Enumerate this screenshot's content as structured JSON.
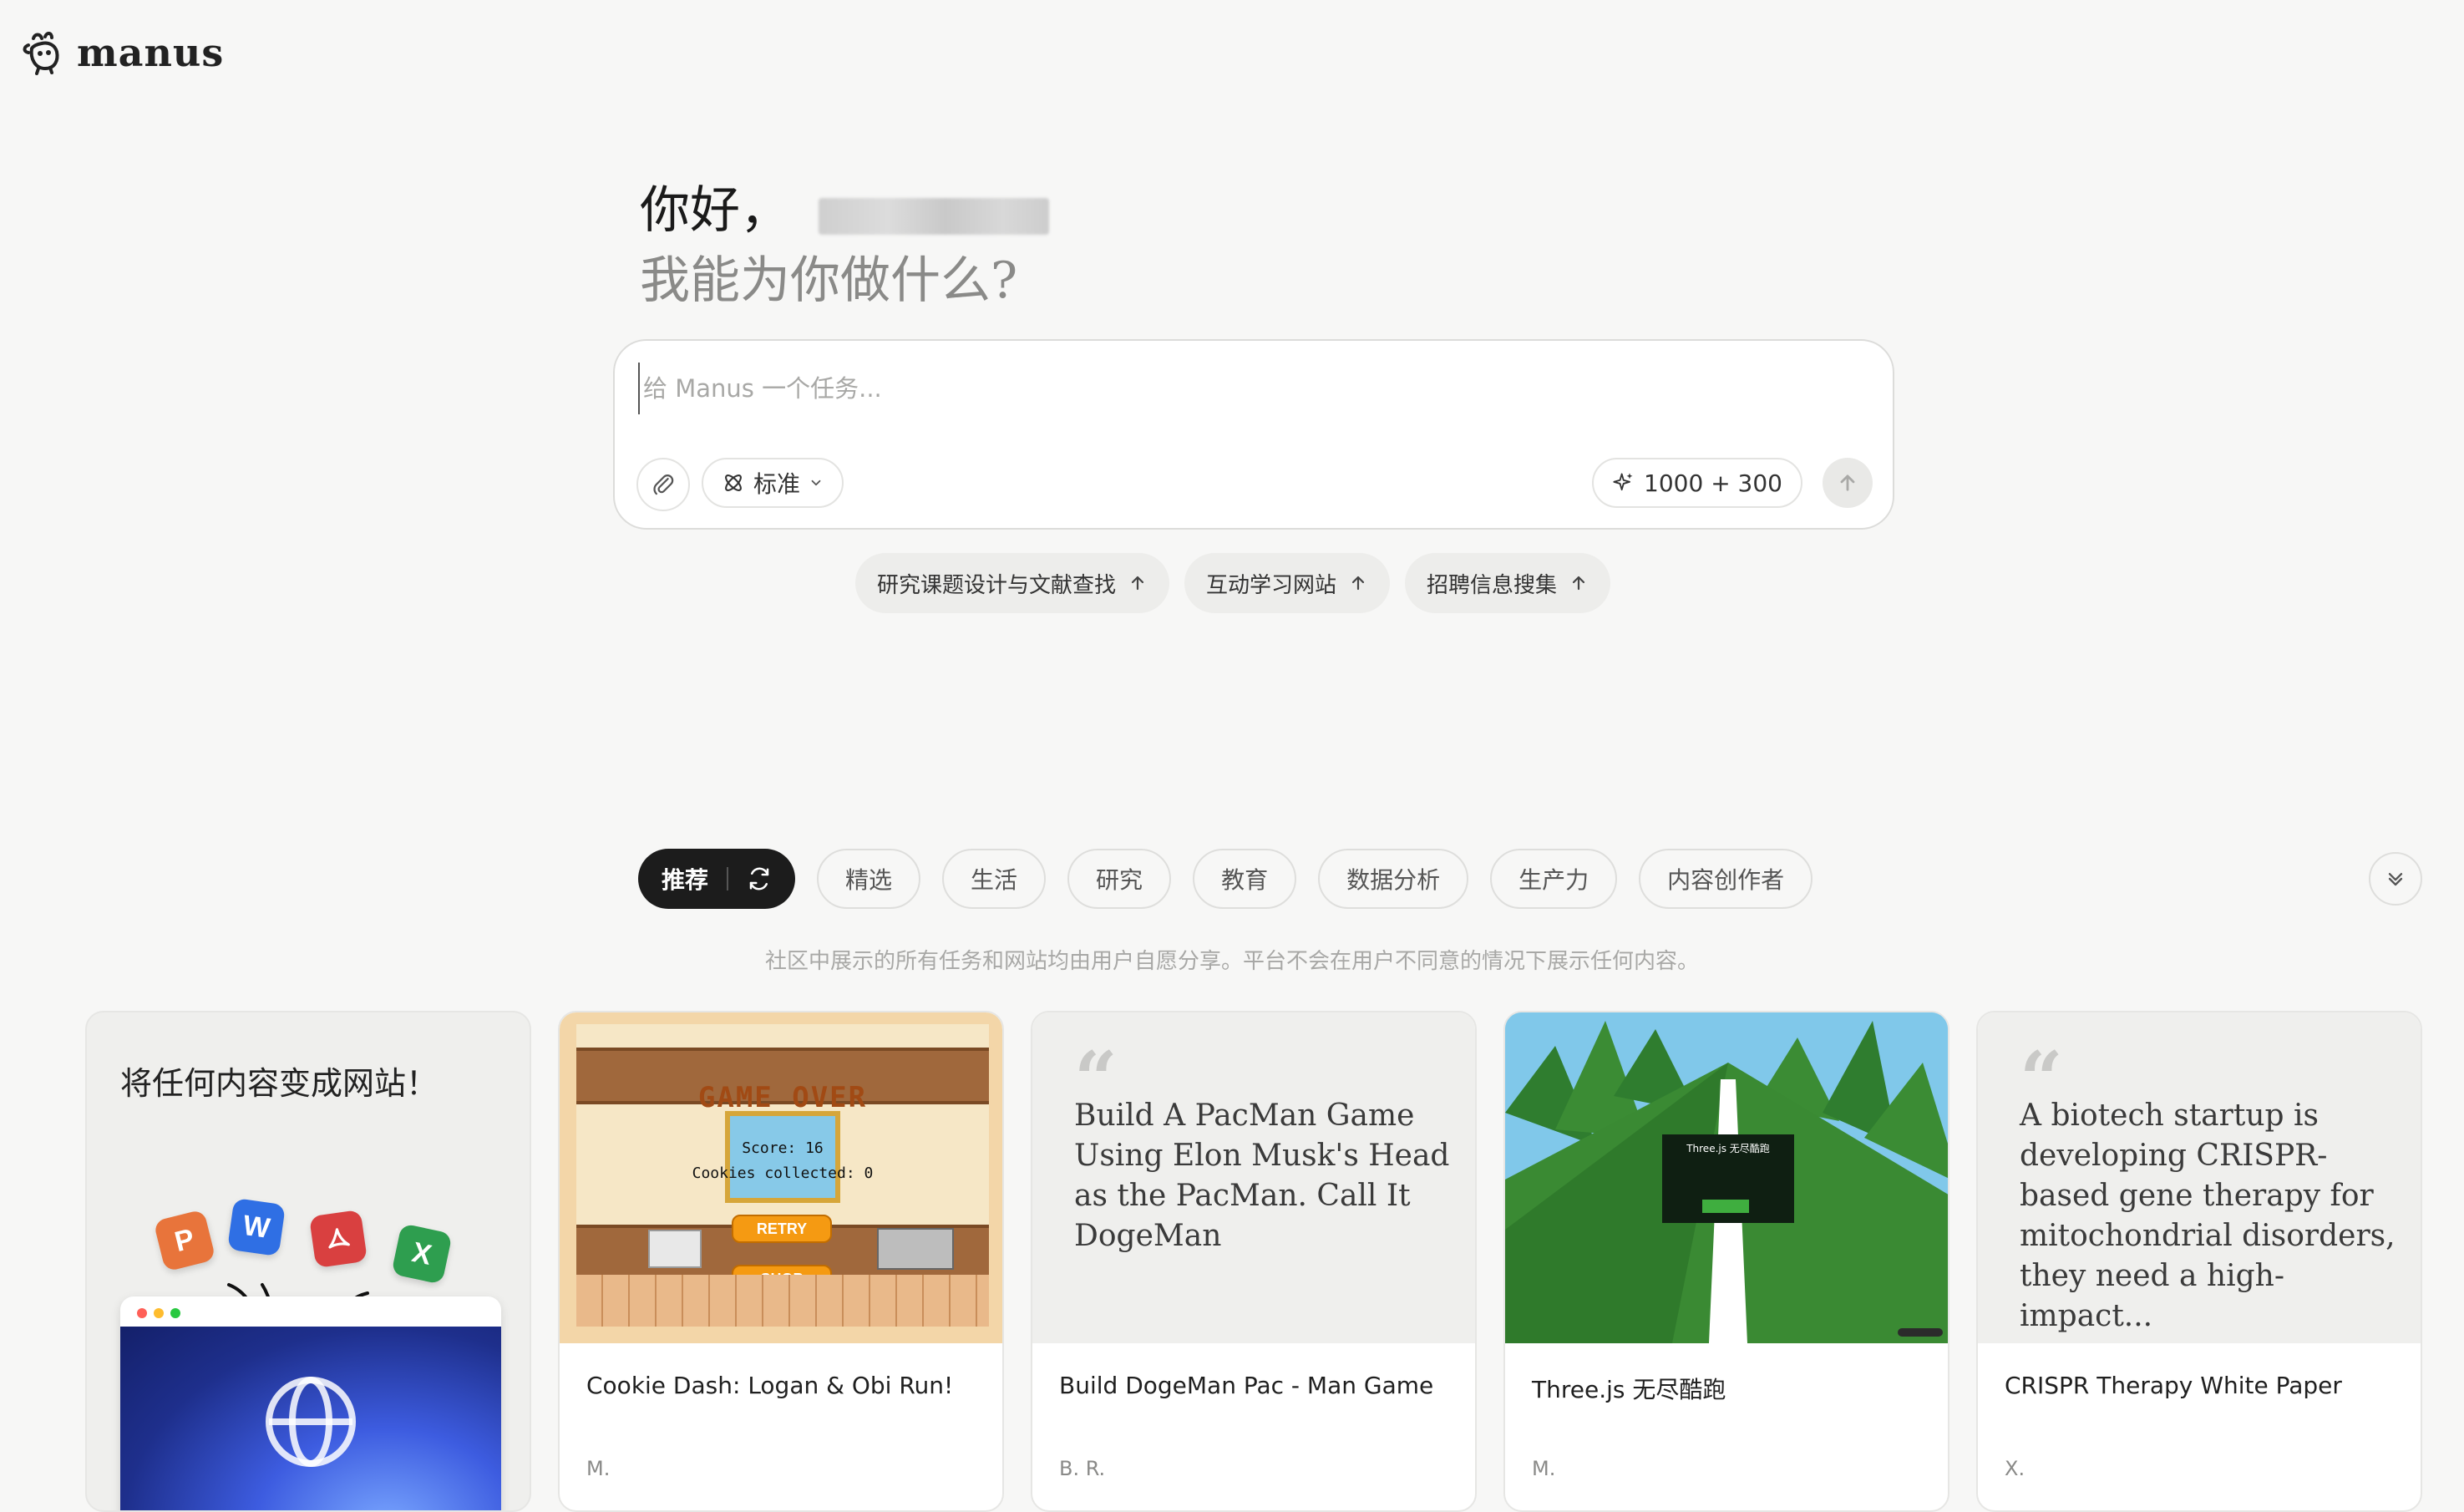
{
  "brand": {
    "name": "manus"
  },
  "greeting": {
    "hello": "你好，",
    "question": "我能为你做什么?"
  },
  "task": {
    "placeholder": "给 Manus 一个任务...",
    "mode_label": "标准",
    "credits_label": "1000 + 300"
  },
  "suggestions": [
    {
      "label": "研究课题设计与文献查找"
    },
    {
      "label": "互动学习网站"
    },
    {
      "label": "招聘信息搜集"
    }
  ],
  "tabs": {
    "active": "推荐",
    "items": [
      "精选",
      "生活",
      "研究",
      "教育",
      "数据分析",
      "生产力",
      "内容创作者"
    ]
  },
  "notice": "社区中展示的所有任务和网站均由用户自愿分享。平台不会在用户不同意的情况下展示任何内容。",
  "promo": {
    "title": "将任何内容变成网站！",
    "apps": [
      "P",
      "W",
      "X"
    ]
  },
  "cards": [
    {
      "title": "Cookie Dash: Logan & Obi Run!",
      "author": "M.",
      "game": {
        "heading": "GAME OVER",
        "score": "Score: 16",
        "cookies": "Cookies collected: 0",
        "retry": "RETRY",
        "shop": "SHOP"
      }
    },
    {
      "title": "Build DogeMan Pac - Man Game",
      "author": "B. R.",
      "quote": "Build A PacMan Game Using Elon Musk's Head as the PacMan. Call It DogeMan"
    },
    {
      "title": "Three.js 无尽酷跑",
      "author": "M.",
      "panel_title": "Three.js 无尽酷跑"
    },
    {
      "title": "CRISPR Therapy White Paper",
      "author": "X.",
      "quote": "A biotech startup is developing CRISPR-based gene therapy for mitochondrial disorders, they need a high-impact..."
    }
  ],
  "colors": {
    "background": "#f7f7f6",
    "active_tab": "#1c1c1c",
    "chip": "#ededeb",
    "tile_p": "#e8743b",
    "tile_w": "#2f6fe4",
    "tile_pdf": "#d94040",
    "tile_x": "#2e9e4f"
  }
}
